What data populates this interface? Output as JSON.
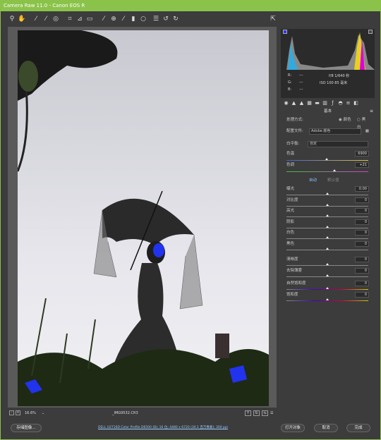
{
  "window": {
    "title": "Camera Raw 11.0 -  Canon EOS R"
  },
  "toolbar": {
    "tools": [
      "zoom",
      "hand",
      "white-balance",
      "color-sampler",
      "targeted-adjustment",
      "crop",
      "straighten",
      "transform",
      "spot-removal",
      "red-eye",
      "adjustment-brush",
      "graduated-filter",
      "radial-filter",
      "open-preferences",
      "rotate-ccw",
      "rotate-cw"
    ],
    "fullscreen_icon": "fullscreen"
  },
  "histogram": {
    "r_label": "R:",
    "g_label": "G:",
    "b_label": "B:",
    "dash": "---",
    "exposure": "f/8   1/640 秒",
    "iso": "ISO 100   85 毫米"
  },
  "panel": {
    "section_title": "基本",
    "process_label": "处理方式:",
    "color_label": "颜色",
    "bw_label": "黑白",
    "profile_label": "配置文件:",
    "profile_value": "Adobe 颜色",
    "wb_label": "白平衡:",
    "wb_value": "自定",
    "temp_label": "色温",
    "temp_value": "6900",
    "tint_label": "色调",
    "tint_value": "+21",
    "auto_label": "自动",
    "default_label": "默认值",
    "sliders": [
      {
        "label": "曝光",
        "value": "0.00"
      },
      {
        "label": "对比度",
        "value": "0"
      },
      {
        "label": "高光",
        "value": "0"
      },
      {
        "label": "阴影",
        "value": "0"
      },
      {
        "label": "白色",
        "value": "0"
      },
      {
        "label": "黑色",
        "value": "0"
      }
    ],
    "sliders2": [
      {
        "label": "清晰度",
        "value": "0"
      },
      {
        "label": "去除薄雾",
        "value": "0"
      }
    ],
    "sliders3": [
      {
        "label": "自然饱和度",
        "value": "0"
      },
      {
        "label": "饱和度",
        "value": "0"
      }
    ]
  },
  "status": {
    "zoom": "16.6%",
    "filename": "_IMG9532.CR3"
  },
  "footer": {
    "save_label": "存储图像...",
    "info_text": "DELL U2716D Color Profile D6500 (8); 16 位; 4480 x 6720 (30.1 百万像素); 300 ppi",
    "open_label": "打开对象",
    "cancel_label": "取消",
    "done_label": "完成"
  },
  "colors": {
    "accent": "#8bc34a",
    "panel": "#3c3c3c"
  }
}
